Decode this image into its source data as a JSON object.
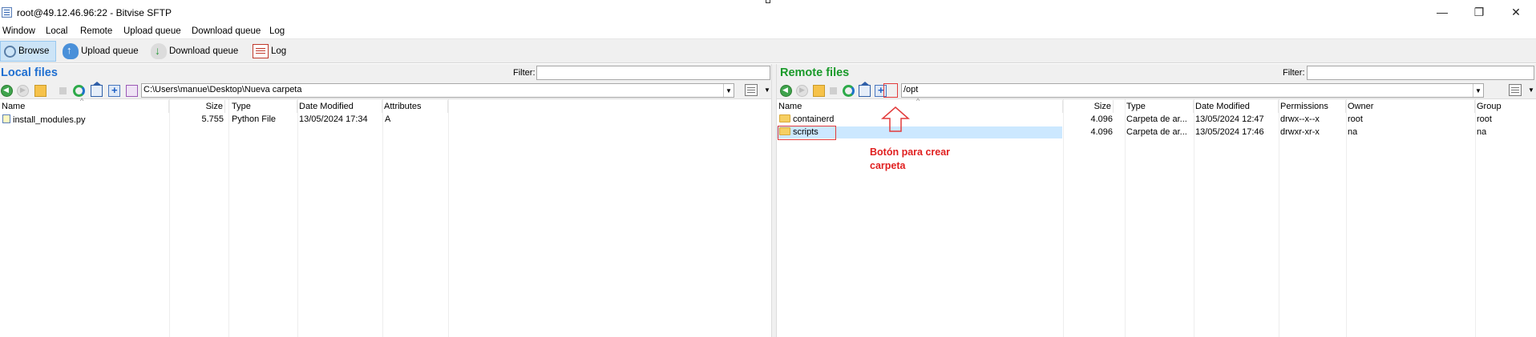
{
  "window": {
    "title": "root@49.12.46.96:22 - Bitvise SFTP",
    "minimize": "—",
    "maximize": "❐",
    "close": "✕"
  },
  "menu": [
    "Window",
    "Local",
    "Remote",
    "Upload queue",
    "Download queue",
    "Log"
  ],
  "toolbar": {
    "browse": "Browse",
    "upload_queue": "Upload queue",
    "download_queue": "Download queue",
    "log": "Log"
  },
  "local": {
    "title": "Local files",
    "filter_label": "Filter:",
    "filter_value": "",
    "path": "C:\\Users\\manue\\Desktop\\Nueva carpeta",
    "columns": [
      "Name",
      "Size",
      "Type",
      "Date Modified",
      "Attributes"
    ],
    "rows": [
      {
        "name": "install_modules.py",
        "size": "5.755",
        "type": "Python File",
        "date": "13/05/2024 17:34",
        "attributes": "A"
      }
    ]
  },
  "remote": {
    "title": "Remote files",
    "filter_label": "Filter:",
    "filter_value": "",
    "path": "/opt",
    "columns": [
      "Name",
      "Size",
      "Type",
      "Date Modified",
      "Permissions",
      "Owner",
      "Group"
    ],
    "rows": [
      {
        "name": "containerd",
        "size": "4.096",
        "type": "Carpeta de ar...",
        "date": "13/05/2024 12:47",
        "permissions": "drwx--x--x",
        "owner": "root",
        "group": "root"
      },
      {
        "name": "scripts",
        "size": "4.096",
        "type": "Carpeta de ar...",
        "date": "13/05/2024 17:46",
        "permissions": "drwxr-xr-x",
        "owner": "na",
        "group": "na"
      }
    ]
  },
  "annotation": {
    "text": "Botón para crear\ncarpeta",
    "color": "#e02020"
  },
  "colors": {
    "local_title": "#1f6fd1",
    "remote_title": "#1a9a2a",
    "selection": "#cce8ff"
  }
}
